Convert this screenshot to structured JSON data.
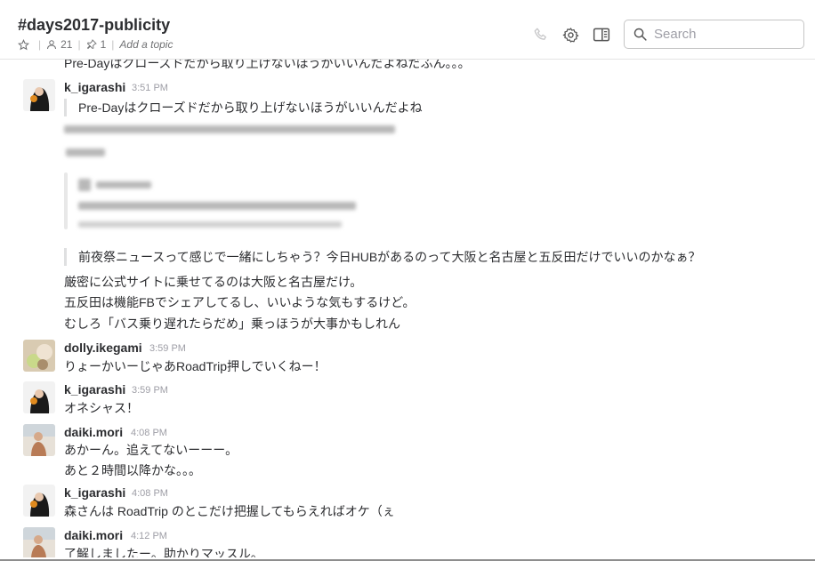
{
  "header": {
    "channel_name": "#days2017-publicity",
    "members_count": "21",
    "pins_count": "1",
    "topic_placeholder": "Add a topic",
    "search_placeholder": "Search",
    "icons": [
      "star-icon",
      "person-icon",
      "pin-icon",
      "phone-icon",
      "gear-icon",
      "sidebar-toggle-icon",
      "search-icon"
    ]
  },
  "messages": {
    "cut_line": "Pre-Dayはクローズドだから取り上げないほうがいいんだよねだふん。。。",
    "m1": {
      "author": "k_igarashi",
      "time": "3:51 PM",
      "quote1": "Pre-Dayはクローズドだから取り上げないほうがいいんだよね",
      "quote2": "前夜祭ニュースって感じで一緒にしちゃう？今日HUBがあるのって大阪と名古屋と五反田だけでいいのかなぁ？",
      "line1": "厳密に公式サイトに乗せてるのは大阪と名古屋だけ。",
      "line2": "五反田は機能FBでシェアしてるし、いいような気もするけど。",
      "line3": "むしろ「バス乗り遅れたらだめ」乗っほうが大事かもしれん"
    },
    "m2": {
      "author": "dolly.ikegami",
      "time": "3:59 PM",
      "line1": "りょーかいーじゃあRoadTrip押しでいくねー！"
    },
    "m3": {
      "author": "k_igarashi",
      "time": "3:59 PM",
      "line1": "オネシャス！"
    },
    "m4": {
      "author": "daiki.mori",
      "time": "4:08 PM",
      "line1": "あかーん。追えてないーーー。",
      "line2": "あと２時間以降かな。。。"
    },
    "m5": {
      "author": "k_igarashi",
      "time": "4:08 PM",
      "line1": "森さんは RoadTrip のとこだけ把握してもらえればオケ（ぇ"
    },
    "m6": {
      "author": "daiki.mori",
      "time": "4:12 PM",
      "line1": "了解しましたー。助かりマッスル。"
    }
  }
}
